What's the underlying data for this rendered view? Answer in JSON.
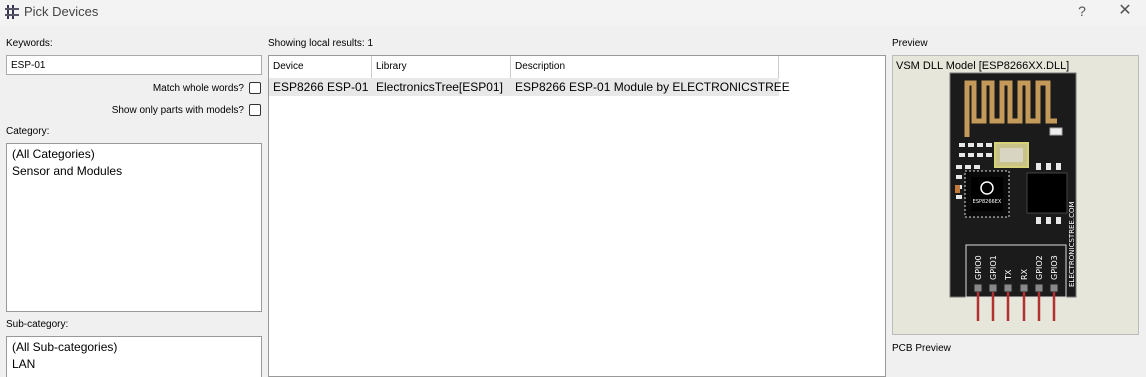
{
  "window": {
    "title": "Pick Devices",
    "help": "?",
    "close": "✕"
  },
  "keywords": {
    "label": "Keywords:",
    "value": "ESP-01"
  },
  "options": {
    "match_whole_words": "Match whole words?",
    "show_only_models": "Show only parts with models?"
  },
  "category": {
    "label": "Category:",
    "items": [
      "(All Categories)",
      "Sensor and Modules"
    ]
  },
  "subcategory": {
    "label": "Sub-category:",
    "items": [
      "(All Sub-categories)",
      "LAN"
    ]
  },
  "results": {
    "summary": "Showing local results: 1",
    "columns": [
      "Device",
      "Library",
      "Description"
    ],
    "rows": [
      {
        "device": "ESP8266 ESP-01",
        "library": "ElectronicsTree[ESP01]",
        "description": "ESP8266 ESP-01 Module by ELECTRONICSTREE"
      }
    ]
  },
  "preview": {
    "label": "Preview",
    "model_text": "VSM DLL Model [ESP8266XX.DLL]",
    "board_brand": "ELECTRONICSTREE.COM",
    "chip_text": "ESP8266EX",
    "pins": [
      "GPIO0",
      "GPIO1",
      "TX",
      "RX",
      "GPIO2",
      "GPIO3"
    ]
  },
  "pcb_preview": {
    "label": "PCB Preview"
  }
}
